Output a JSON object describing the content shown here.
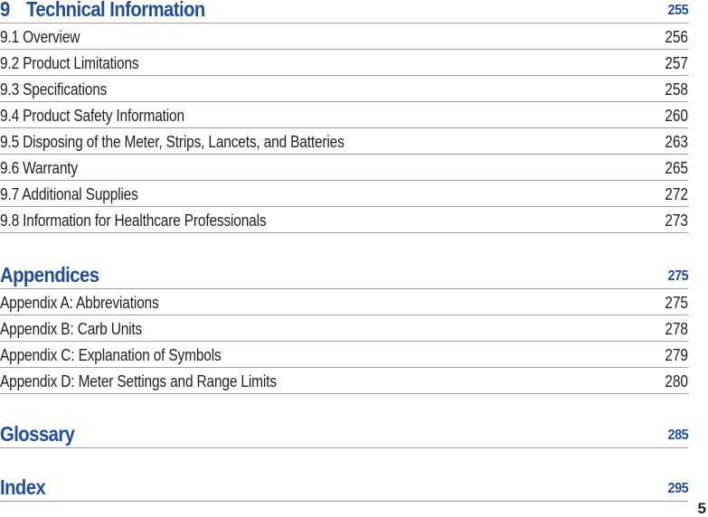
{
  "sections": [
    {
      "chapter_number": "9",
      "title": "Technical Information",
      "page": "255",
      "entries": [
        {
          "label": "9.1 Overview",
          "page": "256"
        },
        {
          "label": "9.2 Product Limitations",
          "page": "257"
        },
        {
          "label": "9.3 Specifications",
          "page": "258"
        },
        {
          "label": "9.4 Product Safety Information",
          "page": "260"
        },
        {
          "label": "9.5 Disposing of the Meter, Strips, Lancets, and Batteries",
          "page": "263"
        },
        {
          "label": "9.6 Warranty",
          "page": "265"
        },
        {
          "label": "9.7 Additional Supplies",
          "page": "272"
        },
        {
          "label": "9.8 Information for Healthcare Professionals",
          "page": "273"
        }
      ]
    },
    {
      "title": "Appendices",
      "page": "275",
      "entries": [
        {
          "label": "Appendix A: Abbreviations",
          "page": "275"
        },
        {
          "label": "Appendix B: Carb Units",
          "page": "278"
        },
        {
          "label": "Appendix C: Explanation of Symbols",
          "page": "279"
        },
        {
          "label": "Appendix D: Meter Settings and Range Limits",
          "page": "280"
        }
      ]
    },
    {
      "title": "Glossary",
      "page": "285"
    },
    {
      "title": "Index",
      "page": "295"
    }
  ],
  "footer": {
    "page_number": "5"
  },
  "colors": {
    "heading": "#1f4e9c",
    "text": "#231f20",
    "rule": "#a0a0a0"
  }
}
